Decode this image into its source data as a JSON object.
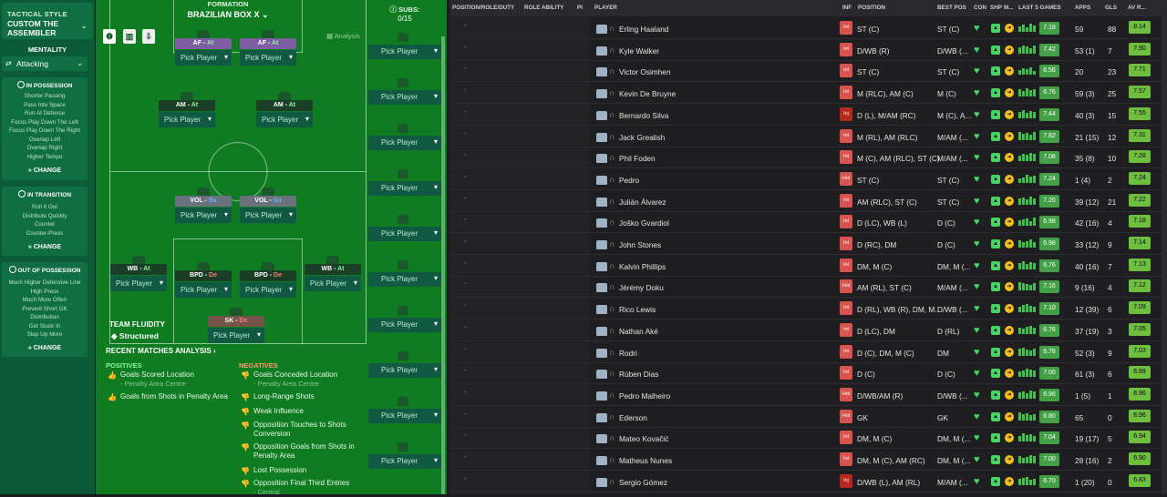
{
  "tactic": {
    "style_label": "TACTICAL STYLE",
    "name": "CUSTOM THE ASSEMBLER",
    "mentality_label": "MENTALITY",
    "mentality": "Attacking"
  },
  "in_possession": {
    "title": "IN POSSESSION",
    "items": [
      "Shorter Passing",
      "Pass Into Space",
      "Run At Defence",
      "Focus Play Down The Left",
      "Focus Play Down The Right",
      "Overlap Left",
      "Overlap Right",
      "Higher Tempo"
    ],
    "change": "CHANGE"
  },
  "in_transition": {
    "title": "IN TRANSITION",
    "items": [
      "Roll It Out",
      "Distribute Quickly",
      "Counter",
      "Counter-Press"
    ],
    "change": "CHANGE"
  },
  "out_of_possession": {
    "title": "OUT OF POSSESSION",
    "items": [
      "Much Higher Defensive Line",
      "High Press",
      "Much More Often",
      "Prevent Short GK",
      "Distribution",
      "Get Stuck In",
      "Step Up More"
    ],
    "change": "CHANGE"
  },
  "formation": {
    "label": "FORMATION",
    "name": "BRAZILIAN BOX X",
    "analysis": "Analysis",
    "subs_label": "SUBS:",
    "subs_count": "0/15",
    "pick": "Pick Player"
  },
  "slots": [
    {
      "role": "AF",
      "duty": "At",
      "color": "pur",
      "duty_class": "at"
    },
    {
      "role": "AF",
      "duty": "At",
      "color": "pur",
      "duty_class": "at"
    },
    {
      "role": "AM",
      "duty": "At",
      "color": "grn",
      "duty_class": "at"
    },
    {
      "role": "AM",
      "duty": "At",
      "color": "grn",
      "duty_class": "at"
    },
    {
      "role": "VOL",
      "duty": "Su",
      "color": "gry",
      "duty_class": "su"
    },
    {
      "role": "VOL",
      "duty": "Su",
      "color": "gry",
      "duty_class": "su"
    },
    {
      "role": "WB",
      "duty": "At",
      "color": "grn",
      "duty_class": "at"
    },
    {
      "role": "BPD",
      "duty": "De",
      "color": "grn",
      "duty_class": "de"
    },
    {
      "role": "BPD",
      "duty": "De",
      "color": "grn",
      "duty_class": "de"
    },
    {
      "role": "WB",
      "duty": "At",
      "color": "grn",
      "duty_class": "at"
    },
    {
      "role": "SK",
      "duty": "De",
      "color": "brn",
      "duty_class": "de"
    }
  ],
  "fluidity": {
    "label": "TEAM FLUIDITY",
    "value": "Structured"
  },
  "analysis": {
    "title": "RECENT MATCHES ANALYSIS",
    "pos_label": "POSITIVES",
    "neg_label": "NEGATIVES",
    "positives": [
      {
        "t": "Goals Scored Location",
        "s": "- Penalty Area Centre"
      },
      {
        "t": "Goals from Shots in Penalty Area",
        "s": ""
      }
    ],
    "negatives": [
      {
        "t": "Goals Conceded Location",
        "s": "- Penalty Area Centre"
      },
      {
        "t": "Long-Range Shots",
        "s": ""
      },
      {
        "t": "Weak Influence",
        "s": ""
      },
      {
        "t": "Opposition Touches to Shots Conversion",
        "s": ""
      },
      {
        "t": "Opposition Goals from Shots in Penalty Area",
        "s": ""
      },
      {
        "t": "Lost Possession",
        "s": ""
      },
      {
        "t": "Opposition Final Third Entries",
        "s": "- Central"
      }
    ]
  },
  "table": {
    "headers": {
      "prd": "POSITION/ROLE/DUTY",
      "ra": "ROLE ABILITY",
      "pi": "PI",
      "player": "PLAYER",
      "inf": "INF",
      "position": "POSITION",
      "best": "BEST POS",
      "con": "CON",
      "shp": "SHP",
      "m": "M...",
      "l5": "LAST 5 GAMES",
      "apps": "APPS",
      "gls": "GLS",
      "avr": "AV R..."
    },
    "rows": [
      {
        "name": "Erling Haaland",
        "inf": "Int",
        "pos": "ST (C)",
        "best": "ST (C)",
        "avg": "7.18",
        "apps": "59",
        "gls": "88",
        "avr": "8.14"
      },
      {
        "name": "Kyle Walker",
        "inf": "Int",
        "pos": "D/WB (R)",
        "best": "D/WB (...",
        "avg": "7.42",
        "apps": "53 (1)",
        "gls": "7",
        "avr": "7.90"
      },
      {
        "name": "Victor Osimhen",
        "inf": "Int",
        "pos": "ST (C)",
        "best": "ST (C)",
        "avg": "6.56",
        "apps": "20",
        "gls": "23",
        "avr": "7.71"
      },
      {
        "name": "Kevin De Bruyne",
        "inf": "Int",
        "pos": "M (RLC), AM (C)",
        "best": "M (C)",
        "avg": "6.76",
        "apps": "59 (3)",
        "gls": "25",
        "avr": "7.57"
      },
      {
        "name": "Bernardo Silva",
        "inf": "Inj",
        "pos": "D (L), M/AM (RC)",
        "best": "M (C), A...",
        "avg": "7.44",
        "apps": "40 (3)",
        "gls": "15",
        "avr": "7.55"
      },
      {
        "name": "Jack Grealish",
        "inf": "Int",
        "pos": "M (RL), AM (RLC)",
        "best": "M/AM (...",
        "avg": "7.82",
        "apps": "21 (15)",
        "gls": "12",
        "avr": "7.31"
      },
      {
        "name": "Phil Foden",
        "inf": "Int",
        "pos": "M (C), AM (RLC), ST (C)",
        "best": "M/AM (...",
        "avg": "7.08",
        "apps": "35 (8)",
        "gls": "10",
        "avr": "7.28"
      },
      {
        "name": "Pedro",
        "inf": "Hol",
        "pos": "ST (C)",
        "best": "ST (C)",
        "avg": "7.24",
        "apps": "1 (4)",
        "gls": "2",
        "avr": "7.24"
      },
      {
        "name": "Julián Álvarez",
        "inf": "Int",
        "pos": "AM (RLC), ST (C)",
        "best": "ST (C)",
        "avg": "7.20",
        "apps": "39 (12)",
        "gls": "21",
        "avr": "7.22"
      },
      {
        "name": "Joško Gvardiol",
        "inf": "Int",
        "pos": "D (LC), WB (L)",
        "best": "D (C)",
        "avg": "6.98",
        "apps": "42 (16)",
        "gls": "4",
        "avr": "7.18"
      },
      {
        "name": "John Stones",
        "inf": "Int",
        "pos": "D (RC), DM",
        "best": "D (C)",
        "avg": "6.98",
        "apps": "33 (12)",
        "gls": "9",
        "avr": "7.14"
      },
      {
        "name": "Kalvin Phillips",
        "inf": "Int",
        "pos": "DM, M (C)",
        "best": "DM, M (...",
        "avg": "6.76",
        "apps": "40 (16)",
        "gls": "7",
        "avr": "7.13"
      },
      {
        "name": "Jérémy Doku",
        "inf": "Hol",
        "pos": "AM (RL), ST (C)",
        "best": "M/AM (...",
        "avg": "7.16",
        "apps": "9 (16)",
        "gls": "4",
        "avr": "7.12"
      },
      {
        "name": "Rico Lewis",
        "inf": "Int",
        "pos": "D (RL), WB (R), DM, M...",
        "best": "D/WB (...",
        "avg": "7.10",
        "apps": "12 (39)",
        "gls": "6",
        "avr": "7.09"
      },
      {
        "name": "Nathan Aké",
        "inf": "Int",
        "pos": "D (LC), DM",
        "best": "D (RL)",
        "avg": "6.76",
        "apps": "37 (19)",
        "gls": "3",
        "avr": "7.05"
      },
      {
        "name": "Rodri",
        "inf": "Int",
        "pos": "D (C), DM, M (C)",
        "best": "DM",
        "avg": "6.78",
        "apps": "52 (3)",
        "gls": "9",
        "avr": "7.03"
      },
      {
        "name": "Rúben Dias",
        "inf": "Int",
        "pos": "D (C)",
        "best": "D (C)",
        "avg": "7.00",
        "apps": "61 (3)",
        "gls": "6",
        "avr": "6.99"
      },
      {
        "name": "Pedro Malheiro",
        "inf": "Hol",
        "pos": "D/WB/AM (R)",
        "best": "D/WB (...",
        "avg": "6.96",
        "apps": "1 (5)",
        "gls": "1",
        "avr": "6.96"
      },
      {
        "name": "Ederson",
        "inf": "Hol",
        "pos": "GK",
        "best": "GK",
        "avg": "6.80",
        "apps": "65",
        "gls": "0",
        "avr": "6.96"
      },
      {
        "name": "Mateo Kovačić",
        "inf": "Int",
        "pos": "DM, M (C)",
        "best": "DM, M (...",
        "avg": "7.04",
        "apps": "19 (17)",
        "gls": "5",
        "avr": "6.94"
      },
      {
        "name": "Matheus Nunes",
        "inf": "Int",
        "pos": "DM, M (C), AM (RC)",
        "best": "DM, M (...",
        "avg": "7.00",
        "apps": "28 (16)",
        "gls": "2",
        "avr": "6.90"
      },
      {
        "name": "Sergio Gómez",
        "inf": "Inj",
        "pos": "D/WB (L), AM (RL)",
        "best": "M/AM (...",
        "avg": "6.70",
        "apps": "1 (20)",
        "gls": "0",
        "avr": "6.83"
      }
    ]
  },
  "colors": {
    "pitch": "#0f7c22",
    "panel": "#0b5a38",
    "rating": "#6fbf3f",
    "injury": "#b7281d"
  }
}
